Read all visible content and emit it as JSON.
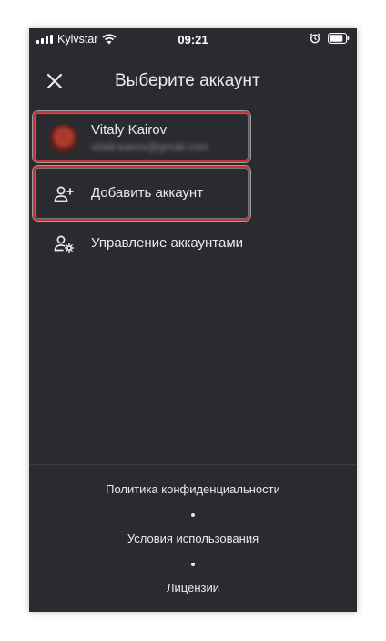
{
  "status_bar": {
    "carrier": "Kyivstar",
    "time": "09:21",
    "icons": [
      "signal-icon",
      "wifi-icon",
      "alarm-icon",
      "battery-icon"
    ]
  },
  "header": {
    "title": "Выберите аккаунт",
    "close_icon": "close-icon"
  },
  "account": {
    "name": "Vitaly Kairov",
    "email": "vitalii.kairov@gmail.com"
  },
  "actions": {
    "add_account": "Добавить аккаунт",
    "manage_accounts": "Управление аккаунтами"
  },
  "footer": {
    "privacy": "Политика конфиденциальности",
    "terms": "Условия использования",
    "licenses": "Лицензии"
  },
  "colors": {
    "background": "#2a2b2f",
    "text": "#e8eaed",
    "highlight": "#c8303a"
  }
}
